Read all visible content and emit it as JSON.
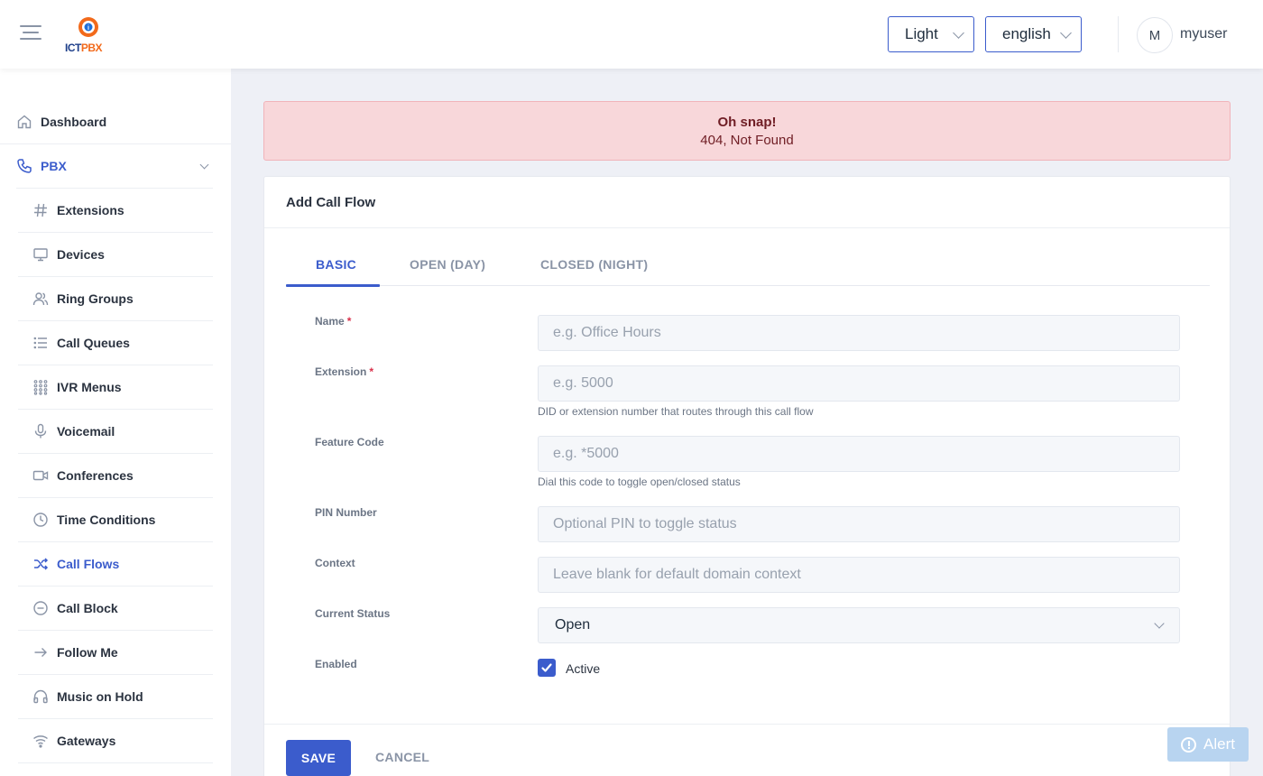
{
  "header": {
    "logo_text_ict": "ICT",
    "logo_text_pbx": "PBX",
    "theme_value": "Light",
    "language_value": "english",
    "avatar_initial": "M",
    "username": "myuser"
  },
  "sidebar": {
    "dashboard": {
      "label": "Dashboard",
      "icon": "home-icon"
    },
    "pbx": {
      "label": "PBX",
      "icon": "phone-icon"
    },
    "items": [
      {
        "label": "Extensions",
        "icon": "hash-icon"
      },
      {
        "label": "Devices",
        "icon": "monitor-icon"
      },
      {
        "label": "Ring Groups",
        "icon": "users-icon"
      },
      {
        "label": "Call Queues",
        "icon": "list-icon"
      },
      {
        "label": "IVR Menus",
        "icon": "keypad-icon"
      },
      {
        "label": "Voicemail",
        "icon": "microphone-icon"
      },
      {
        "label": "Conferences",
        "icon": "video-icon"
      },
      {
        "label": "Time Conditions",
        "icon": "clock-icon"
      },
      {
        "label": "Call Flows",
        "icon": "shuffle-icon",
        "active": true
      },
      {
        "label": "Call Block",
        "icon": "minus-circle-icon"
      },
      {
        "label": "Follow Me",
        "icon": "arrow-right-icon"
      },
      {
        "label": "Music on Hold",
        "icon": "headphones-icon"
      },
      {
        "label": "Gateways",
        "icon": "wifi-icon"
      }
    ]
  },
  "alert": {
    "title": "Oh snap!",
    "message": "404, Not Found"
  },
  "form": {
    "card_title": "Add Call Flow",
    "tabs": [
      "BASIC",
      "OPEN (DAY)",
      "CLOSED (NIGHT)"
    ],
    "active_tab": "BASIC",
    "fields": {
      "name": {
        "label": "Name",
        "required": "*",
        "placeholder": "e.g. Office Hours",
        "value": ""
      },
      "extension": {
        "label": "Extension",
        "required": "*",
        "placeholder": "e.g. 5000",
        "value": "",
        "help": "DID or extension number that routes through this call flow"
      },
      "feature_code": {
        "label": "Feature Code",
        "placeholder": "e.g. *5000",
        "value": "",
        "help": "Dial this code to toggle open/closed status"
      },
      "pin": {
        "label": "PIN Number",
        "placeholder": "Optional PIN to toggle status",
        "value": ""
      },
      "context": {
        "label": "Context",
        "placeholder": "Leave blank for default domain context",
        "value": ""
      },
      "status": {
        "label": "Current Status",
        "value": "Open"
      },
      "enabled": {
        "label": "Enabled",
        "checkbox_label": "Active",
        "checked": true
      }
    },
    "save_label": "SAVE",
    "cancel_label": "CANCEL"
  },
  "float_alert": {
    "label": "Alert",
    "icon": "alert-circle-icon"
  },
  "colors": {
    "primary": "#3b5ccc",
    "danger_bg": "#f8d7da",
    "danger_text": "#6f1d24",
    "required": "#d9304a"
  }
}
